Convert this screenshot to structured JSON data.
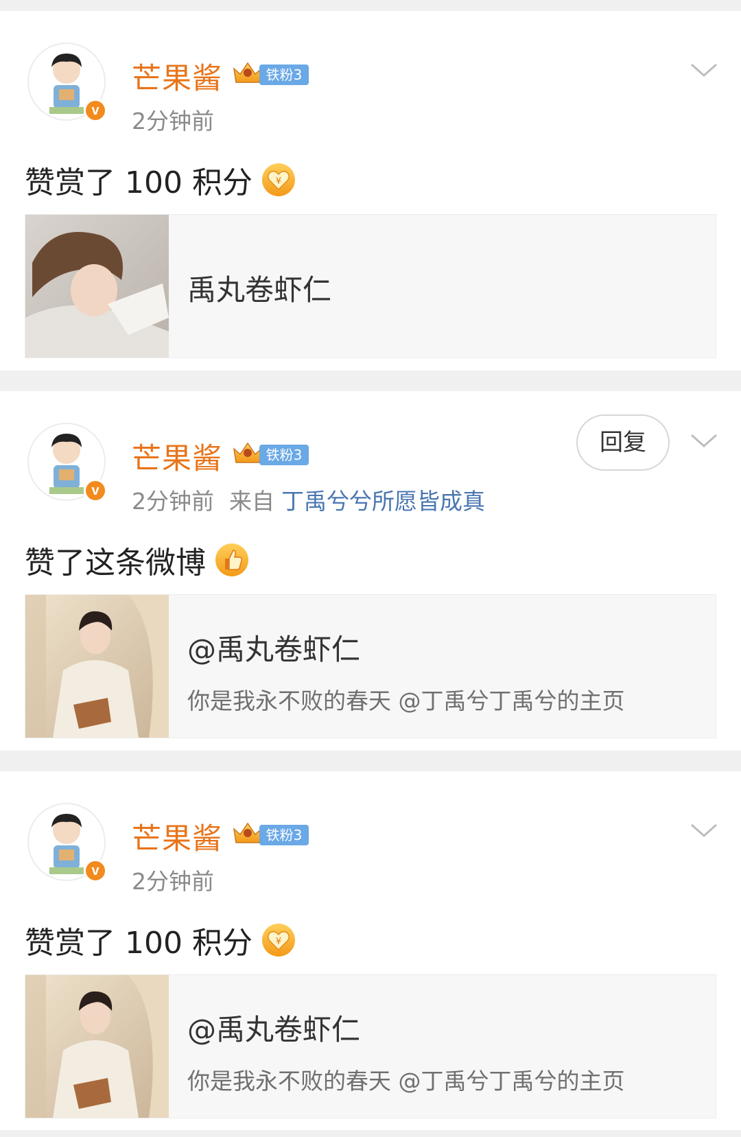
{
  "colors": {
    "username": "#e8741a",
    "link": "#4a76b0",
    "meta": "#8a8a8a",
    "divider": "#f0f0f0",
    "fan_badge": "#6aa8e6",
    "verified_badge": "#f28a1e"
  },
  "feed": [
    {
      "username": "芒果酱",
      "fan_badge": "铁粉3",
      "verified_icon": "v-badge",
      "time": "2分钟前",
      "source_label": "",
      "source_link": "",
      "has_reply": false,
      "action_text": "赞赏了 100 积分",
      "action_icon": "heart-coin-icon",
      "ref_title": "禹丸卷虾仁",
      "ref_subtitle": ""
    },
    {
      "username": "芒果酱",
      "fan_badge": "铁粉3",
      "verified_icon": "v-badge",
      "time": "2分钟前",
      "source_label": "来自",
      "source_link": "丁禹兮兮所愿皆成真",
      "has_reply": true,
      "reply_label": "回复",
      "action_text": "赞了这条微博",
      "action_icon": "thumbs-up-icon",
      "ref_title": "@禹丸卷虾仁",
      "ref_subtitle": "你是我永不败的春天 @丁禹兮丁禹兮的主页"
    },
    {
      "username": "芒果酱",
      "fan_badge": "铁粉3",
      "verified_icon": "v-badge",
      "time": "2分钟前",
      "source_label": "",
      "source_link": "",
      "has_reply": false,
      "action_text": "赞赏了 100 积分",
      "action_icon": "heart-coin-icon",
      "ref_title": "@禹丸卷虾仁",
      "ref_subtitle": "你是我永不败的春天 @丁禹兮丁禹兮的主页"
    }
  ]
}
